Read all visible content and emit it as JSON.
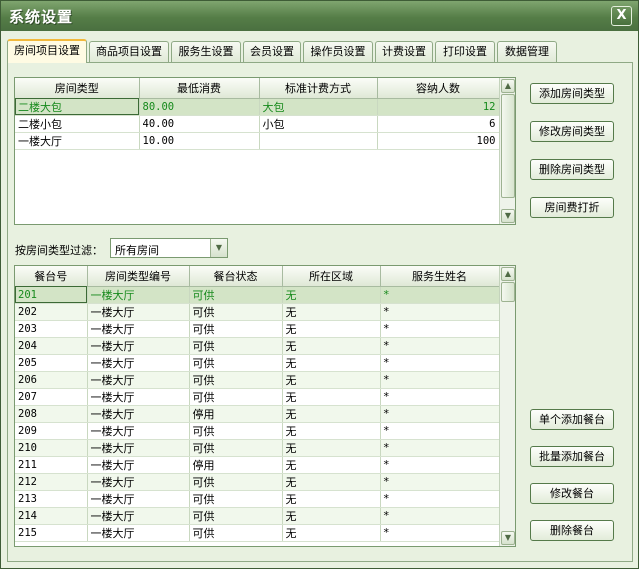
{
  "window": {
    "title": "系统设置",
    "close_label": "X"
  },
  "tabs": [
    {
      "label": "房间项目设置",
      "active": true
    },
    {
      "label": "商品项目设置"
    },
    {
      "label": "服务生设置"
    },
    {
      "label": "会员设置"
    },
    {
      "label": "操作员设置"
    },
    {
      "label": "计费设置"
    },
    {
      "label": "打印设置"
    },
    {
      "label": "数据管理"
    }
  ],
  "room_types": {
    "columns": [
      "房间类型",
      "最低消费",
      "标准计费方式",
      "容纳人数"
    ],
    "rows": [
      [
        "二楼大包",
        "80.00",
        "大包",
        "12"
      ],
      [
        "二楼小包",
        "40.00",
        "小包",
        "6"
      ],
      [
        "一楼大厅",
        "10.00",
        "",
        "100"
      ]
    ]
  },
  "room_buttons": {
    "add_type": "添加房间类型",
    "edit_type": "修改房间类型",
    "delete_type": "删除房间类型",
    "discount": "房间费打折"
  },
  "filter": {
    "label": "按房间类型过滤：",
    "value": "所有房间"
  },
  "tables": {
    "columns": [
      "餐台号",
      "房间类型编号",
      "餐台状态",
      "所在区域",
      "服务生姓名"
    ],
    "rows": [
      [
        "201",
        "一楼大厅",
        "可供",
        "无",
        "*"
      ],
      [
        "202",
        "一楼大厅",
        "可供",
        "无",
        "*"
      ],
      [
        "203",
        "一楼大厅",
        "可供",
        "无",
        "*"
      ],
      [
        "204",
        "一楼大厅",
        "可供",
        "无",
        "*"
      ],
      [
        "205",
        "一楼大厅",
        "可供",
        "无",
        "*"
      ],
      [
        "206",
        "一楼大厅",
        "可供",
        "无",
        "*"
      ],
      [
        "207",
        "一楼大厅",
        "可供",
        "无",
        "*"
      ],
      [
        "208",
        "一楼大厅",
        "停用",
        "无",
        "*"
      ],
      [
        "209",
        "一楼大厅",
        "可供",
        "无",
        "*"
      ],
      [
        "210",
        "一楼大厅",
        "可供",
        "无",
        "*"
      ],
      [
        "211",
        "一楼大厅",
        "停用",
        "无",
        "*"
      ],
      [
        "212",
        "一楼大厅",
        "可供",
        "无",
        "*"
      ],
      [
        "213",
        "一楼大厅",
        "可供",
        "无",
        "*"
      ],
      [
        "214",
        "一楼大厅",
        "可供",
        "无",
        "*"
      ],
      [
        "215",
        "一楼大厅",
        "可供",
        "无",
        "*"
      ]
    ]
  },
  "table_buttons": {
    "add_single": "单个添加餐台",
    "add_batch": "批量添加餐台",
    "edit": "修改餐台",
    "delete": "删除餐台"
  },
  "colors": {
    "title_bar": "#557d47",
    "selected_row_text": "#178a1c",
    "active_tab_accent": "#f2b93b"
  }
}
